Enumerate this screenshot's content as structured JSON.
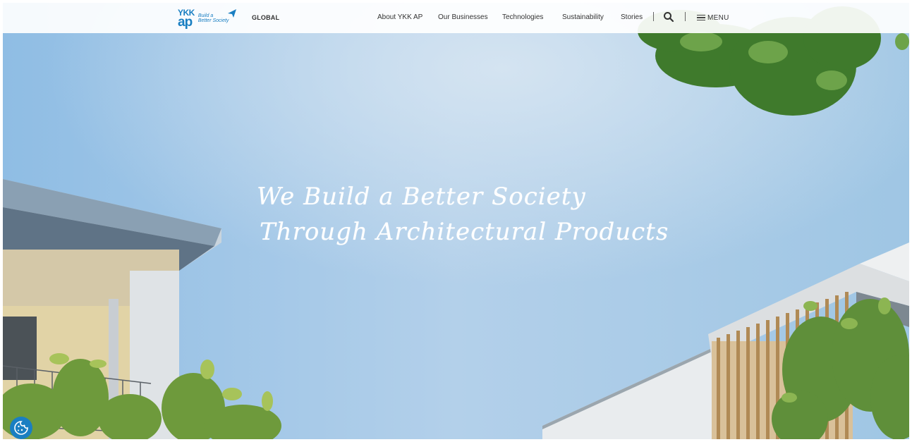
{
  "header": {
    "logo": {
      "line1": "YKK",
      "line2": "ap",
      "tagline1": "Build a",
      "tagline2": "Better Society"
    },
    "region": "GLOBAL",
    "nav": [
      "About YKK AP",
      "Our Businesses",
      "Technologies",
      "Sustainability",
      "Stories"
    ],
    "search_icon": "search-icon",
    "menu_label": "MENU"
  },
  "hero": {
    "headline_line1": "We Build a Better Society",
    "headline_line2": "Through Architectural Products"
  },
  "cookie_button": {
    "icon": "cookie-icon"
  },
  "colors": {
    "brand": "#1a7fc2",
    "sky": "#9ec7e6",
    "header_bg": "#ffffff"
  }
}
